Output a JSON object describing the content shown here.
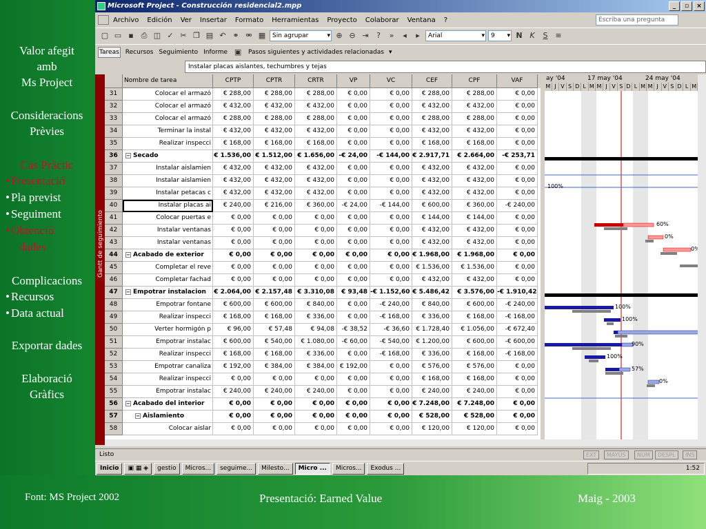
{
  "sidebar": {
    "section1": [
      "Valor afegit",
      "amb",
      "Ms Project"
    ],
    "section2": [
      "Consideracions",
      "Prèvies"
    ],
    "section3_title": "Cas Pràctic",
    "section3_items": [
      "Presentació",
      "Pla previst",
      "Seguiment",
      "Obtenció",
      "dades"
    ],
    "section4_title": "Complicacions",
    "section4_items": [
      "Recursos",
      "Data actual"
    ],
    "section5": "Exportar dades",
    "section6": [
      "Elaboració",
      "Gràfics"
    ]
  },
  "footer": {
    "source": "Font: MS Project 2002",
    "center": "Presentació: Earned Value",
    "date": "Maig - 2003"
  },
  "window": {
    "title": "Microsoft Project - Construcción residencial2.mpp",
    "minimize": "_",
    "maximize": "▫",
    "close": "×"
  },
  "menu": {
    "items": [
      "Archivo",
      "Edición",
      "Ver",
      "Insertar",
      "Formato",
      "Herramientas",
      "Proyecto",
      "Colaborar",
      "Ventana",
      "?"
    ],
    "ask_placeholder": "Escriba una pregunta"
  },
  "toolbar": {
    "group_select": "Sin agrupar",
    "font_select": "Arial",
    "size_select": "9",
    "bold": "N",
    "italic": "K",
    "underline": "S"
  },
  "viewbar": {
    "tabs": [
      "Tareas",
      "Recursos",
      "Seguimiento",
      "Informe"
    ],
    "next_steps": "Pasos siguientes y actividades relacionadas"
  },
  "entry_bar": "Instalar placas aislantes, techumbres y tejas",
  "view_strip": "Gantt de seguimiento",
  "table": {
    "headers": [
      "Nombre de tarea",
      "CPTP",
      "CPTR",
      "CRTR",
      "VP",
      "VC",
      "CEF",
      "CPF",
      "VAF"
    ],
    "rows": [
      {
        "id": "31",
        "name": "Colocar el armazó",
        "cptp": "€ 288,00",
        "cptr": "€ 288,00",
        "crtr": "€ 288,00",
        "vp": "€ 0,00",
        "vc": "€ 0,00",
        "cef": "€ 288,00",
        "cpf": "€ 288,00",
        "vaf": "€ 0,00",
        "kind": "sub"
      },
      {
        "id": "32",
        "name": "Colocar el armazó",
        "cptp": "€ 432,00",
        "cptr": "€ 432,00",
        "crtr": "€ 432,00",
        "vp": "€ 0,00",
        "vc": "€ 0,00",
        "cef": "€ 432,00",
        "cpf": "€ 432,00",
        "vaf": "€ 0,00",
        "kind": "sub"
      },
      {
        "id": "33",
        "name": "Colocar el armazó",
        "cptp": "€ 288,00",
        "cptr": "€ 288,00",
        "crtr": "€ 288,00",
        "vp": "€ 0,00",
        "vc": "€ 0,00",
        "cef": "€ 288,00",
        "cpf": "€ 288,00",
        "vaf": "€ 0,00",
        "kind": "sub"
      },
      {
        "id": "34",
        "name": "Terminar la instal",
        "cptp": "€ 432,00",
        "cptr": "€ 432,00",
        "crtr": "€ 432,00",
        "vp": "€ 0,00",
        "vc": "€ 0,00",
        "cef": "€ 432,00",
        "cpf": "€ 432,00",
        "vaf": "€ 0,00",
        "kind": "sub"
      },
      {
        "id": "35",
        "name": "Realizar inspecci",
        "cptp": "€ 168,00",
        "cptr": "€ 168,00",
        "crtr": "€ 168,00",
        "vp": "€ 0,00",
        "vc": "€ 0,00",
        "cef": "€ 168,00",
        "cpf": "€ 168,00",
        "vaf": "€ 0,00",
        "kind": "sub"
      },
      {
        "id": "36",
        "name": "Secado",
        "cptp": "€ 1.536,00",
        "cptr": "€ 1.512,00",
        "crtr": "€ 1.656,00",
        "vp": "-€ 24,00",
        "vc": "-€ 144,00",
        "cef": "€ 2.917,71",
        "cpf": "€ 2.664,00",
        "vaf": "-€ 253,71",
        "kind": "sum"
      },
      {
        "id": "37",
        "name": "Instalar aislamien",
        "cptp": "€ 432,00",
        "cptr": "€ 432,00",
        "crtr": "€ 432,00",
        "vp": "€ 0,00",
        "vc": "€ 0,00",
        "cef": "€ 432,00",
        "cpf": "€ 432,00",
        "vaf": "€ 0,00",
        "kind": "sub"
      },
      {
        "id": "38",
        "name": "Instalar aislamien",
        "cptp": "€ 432,00",
        "cptr": "€ 432,00",
        "crtr": "€ 432,00",
        "vp": "€ 0,00",
        "vc": "€ 0,00",
        "cef": "€ 432,00",
        "cpf": "€ 432,00",
        "vaf": "€ 0,00",
        "kind": "sub"
      },
      {
        "id": "39",
        "name": "Instalar petacas c",
        "cptp": "€ 432,00",
        "cptr": "€ 432,00",
        "crtr": "€ 432,00",
        "vp": "€ 0,00",
        "vc": "€ 0,00",
        "cef": "€ 432,00",
        "cpf": "€ 432,00",
        "vaf": "€ 0,00",
        "kind": "sub"
      },
      {
        "id": "40",
        "name": "Instalar placas ai",
        "cptp": "€ 240,00",
        "cptr": "€ 216,00",
        "crtr": "€ 360,00",
        "vp": "-€ 24,00",
        "vc": "-€ 144,00",
        "cef": "€ 600,00",
        "cpf": "€ 360,00",
        "vaf": "-€ 240,00",
        "kind": "sel"
      },
      {
        "id": "41",
        "name": "Colocar puertas e",
        "cptp": "€ 0,00",
        "cptr": "€ 0,00",
        "crtr": "€ 0,00",
        "vp": "€ 0,00",
        "vc": "€ 0,00",
        "cef": "€ 144,00",
        "cpf": "€ 144,00",
        "vaf": "€ 0,00",
        "kind": "sub"
      },
      {
        "id": "42",
        "name": "Instalar ventanas",
        "cptp": "€ 0,00",
        "cptr": "€ 0,00",
        "crtr": "€ 0,00",
        "vp": "€ 0,00",
        "vc": "€ 0,00",
        "cef": "€ 432,00",
        "cpf": "€ 432,00",
        "vaf": "€ 0,00",
        "kind": "sub"
      },
      {
        "id": "43",
        "name": "Instalar ventanas",
        "cptp": "€ 0,00",
        "cptr": "€ 0,00",
        "crtr": "€ 0,00",
        "vp": "€ 0,00",
        "vc": "€ 0,00",
        "cef": "€ 432,00",
        "cpf": "€ 432,00",
        "vaf": "€ 0,00",
        "kind": "sub"
      },
      {
        "id": "44",
        "name": "Acabado de exterior",
        "cptp": "€ 0,00",
        "cptr": "€ 0,00",
        "crtr": "€ 0,00",
        "vp": "€ 0,00",
        "vc": "€ 0,00",
        "cef": "€ 1.968,00",
        "cpf": "€ 1.968,00",
        "vaf": "€ 0,00",
        "kind": "sum"
      },
      {
        "id": "45",
        "name": "Completar el reve",
        "cptp": "€ 0,00",
        "cptr": "€ 0,00",
        "crtr": "€ 0,00",
        "vp": "€ 0,00",
        "vc": "€ 0,00",
        "cef": "€ 1.536,00",
        "cpf": "€ 1.536,00",
        "vaf": "€ 0,00",
        "kind": "sub"
      },
      {
        "id": "46",
        "name": "Completar fachad",
        "cptp": "€ 0,00",
        "cptr": "€ 0,00",
        "crtr": "€ 0,00",
        "vp": "€ 0,00",
        "vc": "€ 0,00",
        "cef": "€ 432,00",
        "cpf": "€ 432,00",
        "vaf": "€ 0,00",
        "kind": "sub"
      },
      {
        "id": "47",
        "name": "Empotrar instalacion",
        "cptp": "€ 2.064,00",
        "cptr": "€ 2.157,48",
        "crtr": "€ 3.310,08",
        "vp": "€ 93,48",
        "vc": "-€ 1.152,60",
        "cef": "€ 5.486,42",
        "cpf": "€ 3.576,00",
        "vaf": "-€ 1.910,42",
        "kind": "sum"
      },
      {
        "id": "48",
        "name": "Empotrar fontane",
        "cptp": "€ 600,00",
        "cptr": "€ 600,00",
        "crtr": "€ 840,00",
        "vp": "€ 0,00",
        "vc": "-€ 240,00",
        "cef": "€ 840,00",
        "cpf": "€ 600,00",
        "vaf": "-€ 240,00",
        "kind": "sub"
      },
      {
        "id": "49",
        "name": "Realizar inspecci",
        "cptp": "€ 168,00",
        "cptr": "€ 168,00",
        "crtr": "€ 336,00",
        "vp": "€ 0,00",
        "vc": "-€ 168,00",
        "cef": "€ 336,00",
        "cpf": "€ 168,00",
        "vaf": "-€ 168,00",
        "kind": "sub"
      },
      {
        "id": "50",
        "name": "Verter hormigón p",
        "cptp": "€ 96,00",
        "cptr": "€ 57,48",
        "crtr": "€ 94,08",
        "vp": "-€ 38,52",
        "vc": "-€ 36,60",
        "cef": "€ 1.728,40",
        "cpf": "€ 1.056,00",
        "vaf": "-€ 672,40",
        "kind": "sub"
      },
      {
        "id": "51",
        "name": "Empotrar instalac",
        "cptp": "€ 600,00",
        "cptr": "€ 540,00",
        "crtr": "€ 1.080,00",
        "vp": "-€ 60,00",
        "vc": "-€ 540,00",
        "cef": "€ 1.200,00",
        "cpf": "€ 600,00",
        "vaf": "-€ 600,00",
        "kind": "sub"
      },
      {
        "id": "52",
        "name": "Realizar inspecci",
        "cptp": "€ 168,00",
        "cptr": "€ 168,00",
        "crtr": "€ 336,00",
        "vp": "€ 0,00",
        "vc": "-€ 168,00",
        "cef": "€ 336,00",
        "cpf": "€ 168,00",
        "vaf": "-€ 168,00",
        "kind": "sub"
      },
      {
        "id": "53",
        "name": "Empotrar canaliza",
        "cptp": "€ 192,00",
        "cptr": "€ 384,00",
        "crtr": "€ 384,00",
        "vp": "€ 192,00",
        "vc": "€ 0,00",
        "cef": "€ 576,00",
        "cpf": "€ 576,00",
        "vaf": "€ 0,00",
        "kind": "sub"
      },
      {
        "id": "54",
        "name": "Realizar inspecci",
        "cptp": "€ 0,00",
        "cptr": "€ 0,00",
        "crtr": "€ 0,00",
        "vp": "€ 0,00",
        "vc": "€ 0,00",
        "cef": "€ 168,00",
        "cpf": "€ 168,00",
        "vaf": "€ 0,00",
        "kind": "sub"
      },
      {
        "id": "55",
        "name": "Empotrar instalac",
        "cptp": "€ 240,00",
        "cptr": "€ 240,00",
        "crtr": "€ 240,00",
        "vp": "€ 0,00",
        "vc": "€ 0,00",
        "cef": "€ 240,00",
        "cpf": "€ 240,00",
        "vaf": "€ 0,00",
        "kind": "sub"
      },
      {
        "id": "56",
        "name": "Acabado del interior",
        "cptp": "€ 0,00",
        "cptr": "€ 0,00",
        "crtr": "€ 0,00",
        "vp": "€ 0,00",
        "vc": "€ 0,00",
        "cef": "€ 7.248,00",
        "cpf": "€ 7.248,00",
        "vaf": "€ 0,00",
        "kind": "sum"
      },
      {
        "id": "57",
        "name": "Aislamiento",
        "cptp": "€ 0,00",
        "cptr": "€ 0,00",
        "crtr": "€ 0,00",
        "vp": "€ 0,00",
        "vc": "€ 0,00",
        "cef": "€ 528,00",
        "cpf": "€ 528,00",
        "vaf": "€ 0,00",
        "kind": "sum2"
      },
      {
        "id": "58",
        "name": "Colocar aislar",
        "cptp": "€ 0,00",
        "cptr": "€ 0,00",
        "crtr": "€ 0,00",
        "vp": "€ 0,00",
        "vc": "€ 0,00",
        "cef": "€ 120,00",
        "cpf": "€ 120,00",
        "vaf": "€ 0,00",
        "kind": "sub"
      }
    ]
  },
  "gantt": {
    "weeks": [
      "ay '04",
      "17 may '04",
      "24 may '04"
    ],
    "days": [
      "M",
      "J",
      "V",
      "S",
      "D",
      "L",
      "M",
      "M",
      "J",
      "V",
      "S",
      "D",
      "L",
      "M",
      "M",
      "J",
      "V",
      "S",
      "D",
      "L",
      "M",
      "M"
    ],
    "labels": [
      "100%",
      "60%",
      "0%",
      "0%",
      "100%",
      "100%",
      "90%",
      "100%",
      "57%",
      "0%"
    ]
  },
  "status": {
    "text": "Listo",
    "indicators": [
      "EXT",
      "MAYÚS",
      "NUM",
      "DESPL",
      "INS"
    ]
  },
  "taskbar": {
    "start": "Inicio",
    "buttons": [
      "gestio",
      "Micros...",
      "seguime...",
      "Milesto...",
      "Micro ...",
      "Micros...",
      "Exodus ..."
    ],
    "clock": "1:52"
  },
  "colors": {
    "slide_green": "#0b7327",
    "accent_red": "#c4102a",
    "progress_blue": "#1a1aa0",
    "variance_red": "#cc0000"
  }
}
